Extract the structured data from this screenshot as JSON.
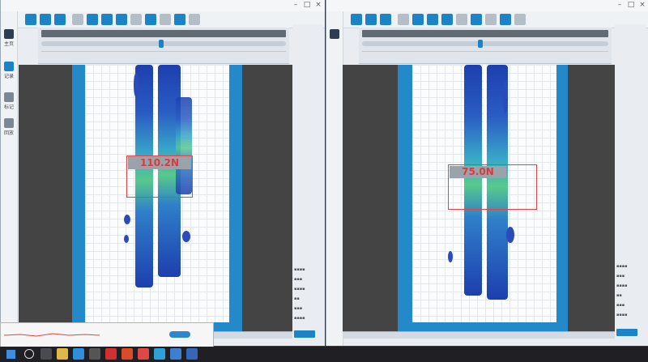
{
  "colors": {
    "accent": "#1d83c7",
    "force_highlight": "#e04545",
    "grid_bg": "#fbfcfd",
    "frame": "#2389c8"
  },
  "left_window": {
    "sidebar": {
      "items": [
        {
          "label": "主页",
          "icon": "home-icon"
        },
        {
          "label": "记录",
          "icon": "record-icon"
        },
        {
          "label": "标记",
          "icon": "tag-icon"
        },
        {
          "label": "回放",
          "icon": "replay-icon"
        }
      ]
    },
    "force_label": "110.2N"
  },
  "right_window": {
    "force_label": "75.0N"
  },
  "taskbar": {
    "start_icon": "windows-icon",
    "search_icon": "search-icon",
    "apps": [
      "file-explorer-icon",
      "edge-icon",
      "media-icon",
      "browser-icon",
      "app-icon",
      "app-icon",
      "app-icon",
      "app-icon",
      "app-icon"
    ]
  }
}
